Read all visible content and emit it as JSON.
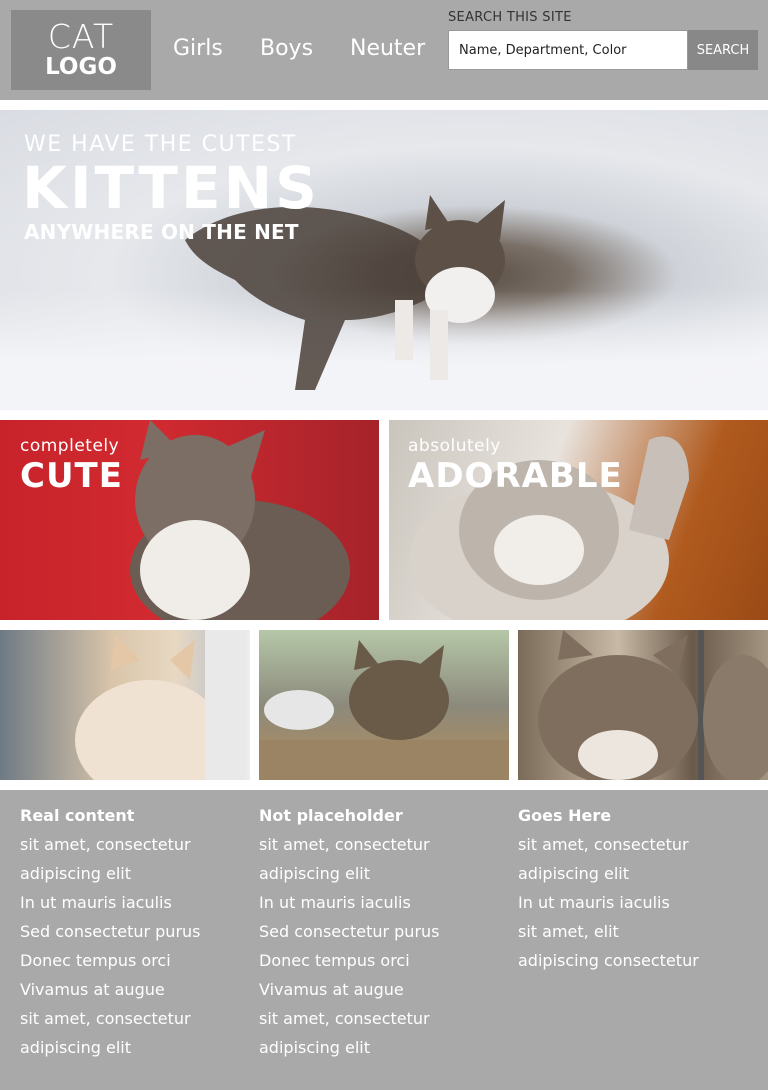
{
  "logo": {
    "line1": "CAT",
    "line2": "LOGO"
  },
  "nav": {
    "items": [
      "Girls",
      "Boys",
      "Neuter"
    ]
  },
  "search": {
    "label": "SEARCH THIS SITE",
    "placeholder": "Name, Department, Color",
    "button": "SEARCH"
  },
  "hero": {
    "line1": "WE HAVE THE CUTEST",
    "line2": "KITTENS",
    "line3": "ANYWHERE ON THE NET"
  },
  "tiles": {
    "left": {
      "small": "completely",
      "big": "CUTE"
    },
    "right": {
      "small": "absolutely",
      "big": "ADORABLE"
    }
  },
  "footer": {
    "columns": [
      {
        "title": "Real content",
        "items": [
          "sit amet, consectetur",
          "adipiscing elit",
          "In ut mauris iaculis",
          "Sed consectetur purus",
          "Donec tempus orci",
          "Vivamus at augue",
          "sit amet, consectetur",
          "adipiscing elit"
        ]
      },
      {
        "title": "Not placeholder",
        "items": [
          "sit amet, consectetur",
          "adipiscing elit",
          "In ut mauris iaculis",
          "Sed consectetur purus",
          "Donec tempus orci",
          "Vivamus at augue",
          "sit amet, consectetur",
          "adipiscing elit"
        ]
      },
      {
        "title": "Goes Here",
        "items": [
          "sit amet, consectetur",
          "adipiscing elit",
          "In ut mauris iaculis",
          "sit amet, elit",
          "adipiscing consectetur"
        ]
      }
    ]
  },
  "colors": {
    "header_bg": "#a9a9a9",
    "logo_bg": "#8a8a8a",
    "search_button_bg": "#888888"
  }
}
